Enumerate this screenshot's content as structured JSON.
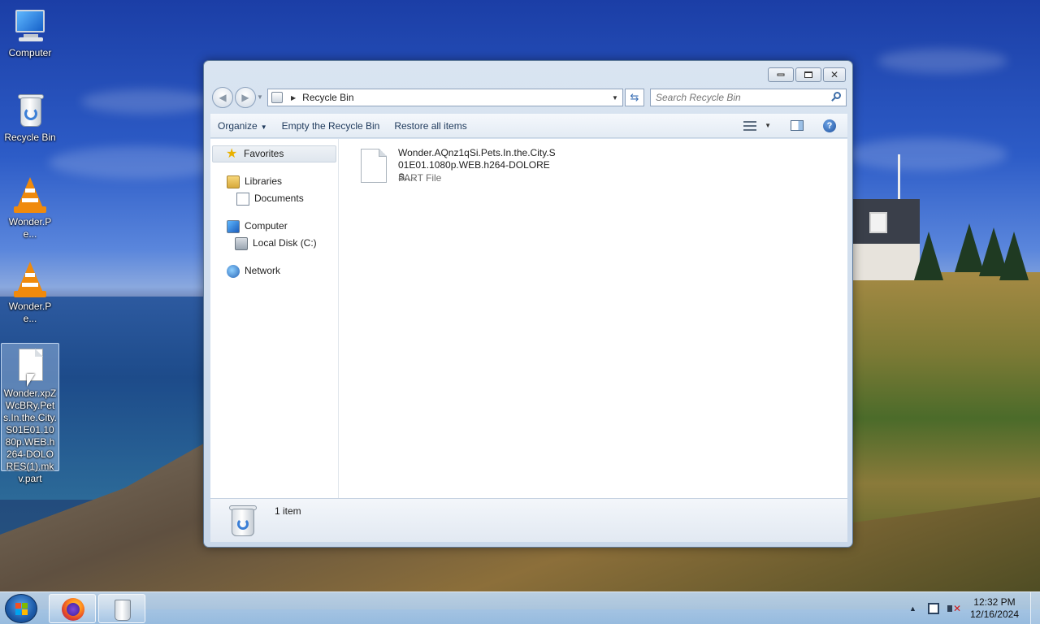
{
  "desktop": {
    "icons": [
      {
        "label": "Computer",
        "icon": "computer-icon"
      },
      {
        "label": "Recycle Bin",
        "icon": "recycle-bin-icon"
      },
      {
        "label": "Wonder.Pe...",
        "icon": "vlc-icon"
      },
      {
        "label": "Wonder.Pe...",
        "icon": "vlc-icon"
      },
      {
        "label": "Wonder.xpZWcBRy.Pets.In.the.City.S01E01.1080p.WEB.h264-DOLORES(1).mkv.part",
        "icon": "file-icon"
      }
    ]
  },
  "window": {
    "address": {
      "location": "Recycle Bin"
    },
    "search": {
      "placeholder": "Search Recycle Bin"
    },
    "toolbar": {
      "organize": "Organize",
      "empty": "Empty the Recycle Bin",
      "restore": "Restore all items"
    },
    "nav_pane": {
      "favorites": "Favorites",
      "libraries": "Libraries",
      "documents": "Documents",
      "computer": "Computer",
      "local_disk": "Local Disk (C:)",
      "network": "Network"
    },
    "files": [
      {
        "name": "Wonder.AQnz1qSi.Pets.In.the.City.S01E01.1080p.WEB.h264-DOLORES....",
        "type": "PART File"
      }
    ],
    "details": {
      "count": "1 item"
    }
  },
  "taskbar": {
    "pinned": [
      "firefox-icon",
      "recycle-bin-icon"
    ],
    "clock": {
      "time": "12:32 PM",
      "date": "12/16/2024"
    }
  }
}
